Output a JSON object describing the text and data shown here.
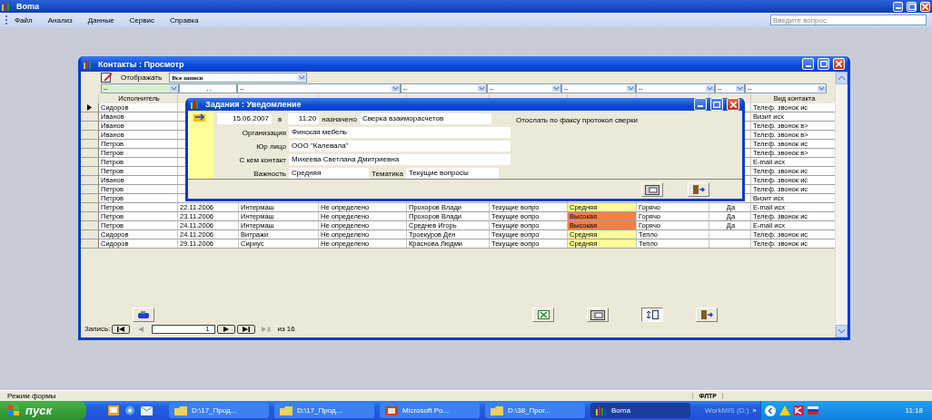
{
  "app": {
    "title": "Boma"
  },
  "menu": [
    {
      "label": "Файл"
    },
    {
      "label": "Анализ"
    },
    {
      "label": "Данные"
    },
    {
      "label": "Сервис"
    },
    {
      "label": "Справка"
    }
  ],
  "help_field": {
    "placeholder": "Введите вопрос"
  },
  "contacts_window": {
    "title": "Контакты : Просмотр",
    "show_label": "Отображать",
    "show_value": "Все записи",
    "filters": [
      {
        "kind": "combo",
        "value": "--",
        "color": "#d8f0d0"
      },
      {
        "kind": "date",
        "value": ". ."
      },
      {
        "kind": "combo",
        "value": "--"
      },
      {
        "kind": "combo",
        "value": "--"
      },
      {
        "kind": "combo",
        "value": "--"
      },
      {
        "kind": "combo",
        "value": "--"
      },
      {
        "kind": "combo",
        "value": "--"
      },
      {
        "kind": "combo",
        "value": "--"
      },
      {
        "kind": "combo",
        "value": "--"
      }
    ],
    "header": {
      "executor": "Исполнитель",
      "contact_type": "Вид контакта"
    },
    "rows": [
      {
        "selected": true,
        "executor": "Сидоров",
        "contact_type": "Телеф. звонок ис"
      },
      {
        "selected": false,
        "executor": "Иванов",
        "contact_type": "Визит исх"
      },
      {
        "selected": false,
        "executor": "Иванов",
        "contact_type": "Телеф. звонок в>"
      },
      {
        "selected": false,
        "executor": "Иванов",
        "contact_type": "Телеф. звонок в>"
      },
      {
        "selected": false,
        "executor": "Петров",
        "contact_type": "Телеф. звонок ис"
      },
      {
        "selected": false,
        "executor": "Петров",
        "contact_type": "Телеф. звонок в>"
      },
      {
        "selected": false,
        "executor": "Петров",
        "contact_type": "E-mail исх"
      },
      {
        "selected": false,
        "executor": "Петров",
        "contact_type": "Телеф. звонок ис"
      },
      {
        "selected": false,
        "executor": "Иванов",
        "contact_type": "Телеф. звонок ис"
      },
      {
        "selected": false,
        "executor": "Петров",
        "contact_type": "Телеф. звонок ис"
      },
      {
        "selected": false,
        "executor": "Петров",
        "contact_type": "Визит исх"
      },
      {
        "selected": false,
        "executor": "Петров",
        "date": "22.11.2006",
        "org": "Интермаш",
        "status": "Не определено",
        "person": "Прохоров Влади",
        "topic": "Текущие вопро",
        "importance": {
          "text": "Средняя",
          "color": "#ffff99"
        },
        "temperature": "Горячо",
        "done": "Да",
        "contact_type": "E-mail исх"
      },
      {
        "selected": false,
        "executor": "Петров",
        "date": "23.11.2006",
        "org": "Интермаш",
        "status": "Не определено",
        "person": "Прохоров Влади",
        "topic": "Текущие вопро",
        "importance": {
          "text": "Высокая",
          "color": "#f0804c"
        },
        "temperature": "Горячо",
        "done": "Да",
        "contact_type": "Телеф. звонок ис"
      },
      {
        "selected": false,
        "executor": "Петров",
        "date": "24.11.2006",
        "org": "Интермаш",
        "status": "Не определено",
        "person": "Среднев Игорь",
        "topic": "Текущие вопро",
        "importance": {
          "text": "Высокая",
          "color": "#f0804c"
        },
        "temperature": "Горячо",
        "done": "Да",
        "contact_type": "E-mail исх"
      },
      {
        "selected": false,
        "executor": "Сидоров",
        "date": "24.11.2006",
        "org": "Витражи",
        "status": "Не определено",
        "person": "Троекуров Ден",
        "topic": "Текущие вопро",
        "importance": {
          "text": "Средняя",
          "color": "#ffff99"
        },
        "temperature": "Тепло",
        "contact_type": "Телеф. звонок ис"
      },
      {
        "selected": false,
        "executor": "Сидоров",
        "date": "29.11.2006",
        "org": "Сириус",
        "status": "Не определено",
        "person": "Краснова Людми",
        "topic": "Текущие вопро",
        "importance": {
          "text": "Средняя",
          "color": "#ffff99"
        },
        "temperature": "Тепло",
        "contact_type": "Телеф. звонок ис"
      }
    ],
    "buttons": [
      {
        "kind": "back",
        "pressed": false
      },
      {
        "kind": "spreadsheet",
        "pressed": false
      },
      {
        "kind": "form",
        "pressed": false
      },
      {
        "kind": "list",
        "pressed": true
      },
      {
        "kind": "exit",
        "pressed": false
      }
    ],
    "navigator": {
      "label": "Запись:",
      "record": "1",
      "total": "из 16"
    }
  },
  "dialog": {
    "title": "Задания : Уведомление",
    "date": "15.06.2007",
    "at_label": "в",
    "time": "11:20",
    "assigned_label": "назначено",
    "task": "Сверка взаиморасчетов",
    "note": "Отослать по факсу протокол сверки",
    "fields": [
      {
        "label": "Организация",
        "value": "Финская мебель"
      },
      {
        "label": "Юр лицо",
        "value": "ООО \"Калевала\""
      },
      {
        "label": "С кем контакт",
        "value": "Михеева Светлана Дмитриевна"
      }
    ],
    "importance": {
      "label": "Важность",
      "value": "Средняя"
    },
    "topic": {
      "label": "Тематика",
      "value": "Текущие вопросы"
    },
    "buttons": [
      {
        "kind": "form",
        "pressed": false
      },
      {
        "kind": "exit",
        "pressed": false
      }
    ]
  },
  "status_bar": {
    "mode": "Режим формы",
    "filter": "ФЛТР"
  },
  "taskbar": {
    "start": "пуск",
    "tasks": [
      {
        "kind": "folder",
        "label": "D:\\17_Прод...",
        "selected": false
      },
      {
        "kind": "folder",
        "label": "D:\\17_Прод...",
        "selected": false
      },
      {
        "kind": "presentation",
        "label": "Microsoft Po...",
        "selected": false
      },
      {
        "kind": "folder",
        "label": "D:\\38_Прог...",
        "selected": false
      },
      {
        "kind": "app",
        "label": "Boma",
        "selected": true
      }
    ],
    "toolbar_label": "WorkMIS (D:)",
    "more": "»",
    "clock": "11:18"
  }
}
